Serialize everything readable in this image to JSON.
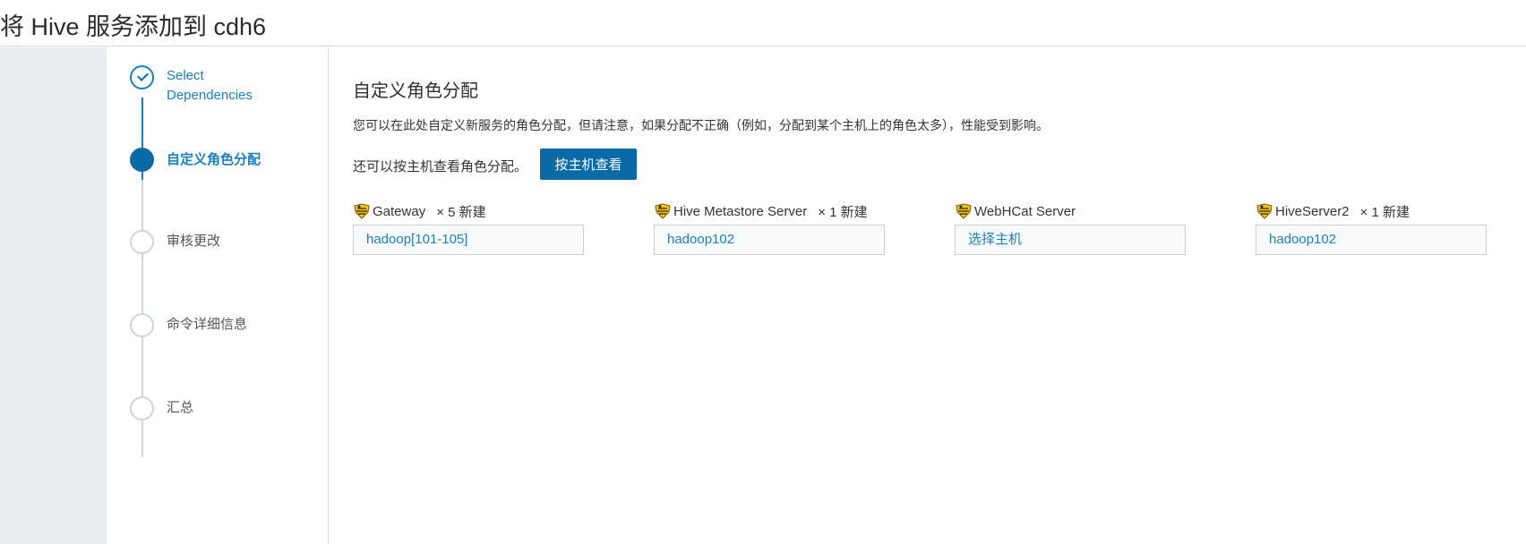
{
  "header": {
    "title": "将 Hive 服务添加到 cdh6"
  },
  "wizard": {
    "steps": [
      {
        "label": "Select\nDependencies",
        "state": "done"
      },
      {
        "label": "自定义角色分配",
        "state": "active"
      },
      {
        "label": "审核更改",
        "state": "pending"
      },
      {
        "label": "命令详细信息",
        "state": "pending"
      },
      {
        "label": "汇总",
        "state": "pending"
      }
    ]
  },
  "content": {
    "title": "自定义角色分配",
    "description": "您可以在此处自定义新服务的角色分配，但请注意，如果分配不正确（例如，分配到某个主机上的角色太多），性能受到影响。",
    "by_host_text": "还可以按主机查看角色分配。",
    "by_host_button": "按主机查看",
    "roles": [
      {
        "name": "Gateway",
        "count": "× 5 新建",
        "hosts": "hadoop[101-105]",
        "icon": "hive-bee-icon"
      },
      {
        "name": "Hive Metastore Server",
        "count": "× 1 新建",
        "hosts": "hadoop102",
        "icon": "hive-bee-icon"
      },
      {
        "name": "WebHCat Server",
        "count": "",
        "hosts": "选择主机",
        "icon": "hive-bee-icon"
      },
      {
        "name": "HiveServer2",
        "count": "× 1 新建",
        "hosts": "hadoop102",
        "icon": "hive-bee-icon"
      }
    ]
  },
  "colors": {
    "accent": "#0a6aa6",
    "link": "#1b7fb8",
    "rail": "#e9edf0"
  }
}
